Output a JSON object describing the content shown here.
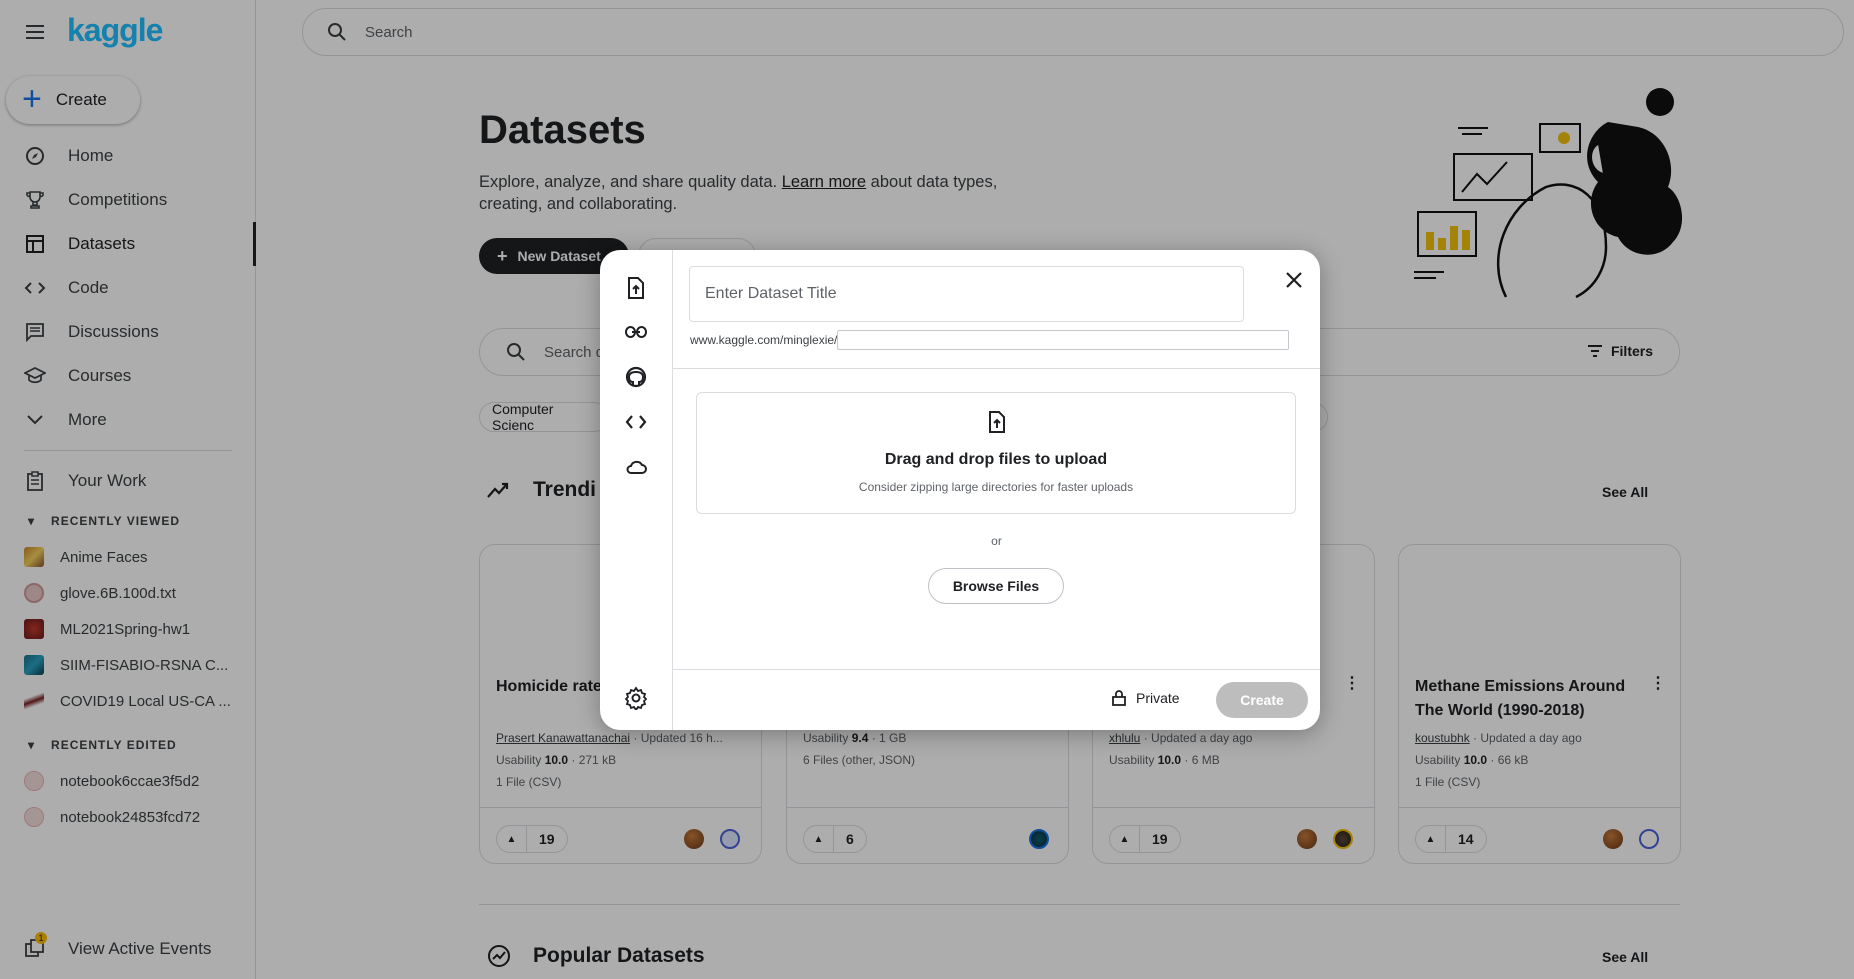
{
  "sidebar": {
    "logo": "kaggle",
    "create_label": "Create",
    "nav": [
      {
        "label": "Home",
        "icon": "compass-icon"
      },
      {
        "label": "Competitions",
        "icon": "trophy-icon"
      },
      {
        "label": "Datasets",
        "icon": "table-icon",
        "active": true
      },
      {
        "label": "Code",
        "icon": "code-icon"
      },
      {
        "label": "Discussions",
        "icon": "comment-icon"
      },
      {
        "label": "Courses",
        "icon": "school-icon"
      },
      {
        "label": "More",
        "icon": "chevron-down-icon"
      }
    ],
    "your_work": "Your Work",
    "recently_viewed_label": "RECENTLY VIEWED",
    "recently_viewed": [
      "Anime Faces",
      "glove.6B.100d.txt",
      "ML2021Spring-hw1",
      "SIIM-FISABIO-RSNA C...",
      "COVID19 Local US-CA ..."
    ],
    "recently_edited_label": "RECENTLY EDITED",
    "recently_edited": [
      "notebook6ccae3f5d2",
      "notebook24853fcd72"
    ],
    "events_label": "View Active Events",
    "events_badge": "1"
  },
  "top_search": {
    "placeholder": "Search"
  },
  "main": {
    "title": "Datasets",
    "desc_before": "Explore, analyze, and share quality data. ",
    "desc_link": "Learn more",
    "desc_after": " about data types, creating, and collaborating.",
    "new_dataset": "New Dataset",
    "search_placeholder": "Search da",
    "filters": "Filters",
    "chip": "Computer Scienc",
    "trending": "Trendi",
    "popular": "Popular Datasets",
    "see_all": "See All"
  },
  "cards": [
    {
      "title": "Homicide rate and GDP",
      "author": "Prasert Kanawattanachai",
      "updated": " · Updated 16 h...",
      "usability": "10.0",
      "size": " · 271 kB",
      "files": "1 File (CSV)",
      "votes": "19"
    },
    {
      "title": "",
      "author": "",
      "updated": "",
      "usability": "9.4",
      "size": " · 1 GB",
      "files": "6 Files (other, JSON)",
      "votes": "6"
    },
    {
      "title": "",
      "author": "xhlulu",
      "updated": " · Updated a day ago",
      "usability": "10.0",
      "size": " · 6 MB",
      "files": "",
      "votes": "19"
    },
    {
      "title": "Methane Emissions Around The World (1990-2018)",
      "author": "koustubhk",
      "updated": " · Updated a day ago",
      "usability": "10.0",
      "size": " · 66 kB",
      "files": "1 File (CSV)",
      "votes": "14"
    }
  ],
  "usability_label": "Usability ",
  "modal": {
    "title_placeholder": "Enter Dataset Title",
    "url_prefix": "www.kaggle.com/minglexie/",
    "drop_title": "Drag and drop files to upload",
    "drop_sub": "Consider zipping large directories for faster uploads",
    "or": "or",
    "browse": "Browse Files",
    "private": "Private",
    "create": "Create"
  },
  "colors": {
    "brand": "#20beff",
    "overlay": "rgba(0,0,0,0.32)"
  }
}
